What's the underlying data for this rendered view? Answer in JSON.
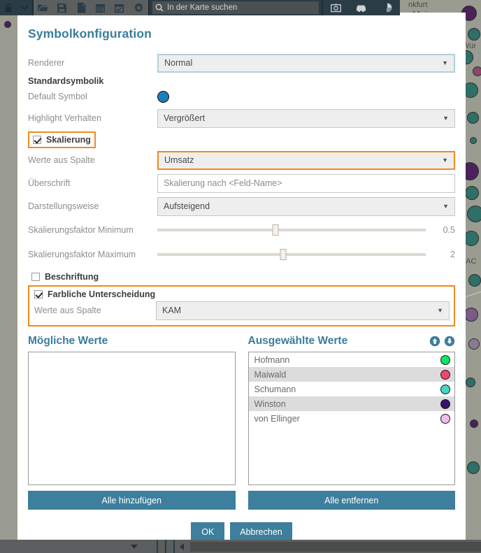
{
  "toolbar": {
    "icons": [
      {
        "name": "lock-icon",
        "label": "Sperren"
      },
      {
        "name": "chevron-down-icon",
        "label": "Mehr"
      },
      {
        "name": "folder-open-icon",
        "label": "Öffnen"
      },
      {
        "name": "save-icon",
        "label": "Speichern"
      },
      {
        "name": "new-document-icon",
        "label": "Neu"
      },
      {
        "name": "calendar-icon",
        "label": "Kalender"
      },
      {
        "name": "calendar-check-icon",
        "label": "Termin"
      },
      {
        "name": "gear-icon",
        "label": "Einstellungen"
      }
    ],
    "right_icons": [
      {
        "name": "camera-icon",
        "label": "Screenshot"
      },
      {
        "name": "car-icon",
        "label": "Route"
      },
      {
        "name": "pie-chart-icon",
        "label": "Diagramm"
      }
    ]
  },
  "search": {
    "placeholder": "In der Karte suchen",
    "icon": "search-icon"
  },
  "map": {
    "labels": [
      "nkfurt",
      "Main",
      "Wür",
      "FAC"
    ]
  },
  "dialog": {
    "title": "Symbolkonfiguration",
    "renderer": {
      "label": "Renderer",
      "value": "Normal"
    },
    "standard_section": {
      "heading": "Standardsymbolik",
      "default_symbol_label": "Default Symbol",
      "default_symbol_color": "#1b7fbd",
      "highlight_label": "Highlight Verhalten",
      "highlight_value": "Vergrößert"
    },
    "scaling": {
      "checkbox_label": "Skalierung",
      "checked": true,
      "column_label": "Werte aus Spalte",
      "column_value": "Umsatz",
      "caption_label": "Überschrift",
      "caption_value": "Skalierung nach <Feld-Name>",
      "mode_label": "Darstellungsweise",
      "mode_value": "Aufsteigend",
      "min_label": "Skalierungsfaktor Minimum",
      "min_value": "0.5",
      "min_percent": 44,
      "max_label": "Skalierungsfaktor Maximum",
      "max_value": "2",
      "max_percent": 47
    },
    "labeling": {
      "checkbox_label": "Beschriftung",
      "checked": false
    },
    "color_coding": {
      "checkbox_label": "Farbliche Unterscheidung",
      "checked": true,
      "column_label": "Werte aus Spalte",
      "column_value": "KAM"
    },
    "lists": {
      "available_title": "Mögliche Werte",
      "selected_title": "Ausgewählte Werte",
      "move_up_icon": "arrow-up-circle-icon",
      "move_down_icon": "arrow-down-circle-icon",
      "available_items": [],
      "selected_items": [
        {
          "label": "Hofmann",
          "color": "#10e466"
        },
        {
          "label": "Maiwald",
          "color": "#f2456e"
        },
        {
          "label": "Schumann",
          "color": "#3fd8c6"
        },
        {
          "label": "Winston",
          "color": "#3d0d6b"
        },
        {
          "label": "von Ellinger",
          "color": "#f0bce9"
        }
      ],
      "add_all_label": "Alle hinzufügen",
      "remove_all_label": "Alle entfernen"
    },
    "footer": {
      "ok_label": "OK",
      "cancel_label": "Abbrechen"
    },
    "accent_color": "#3a7e9c",
    "highlight_color": "#f08a1e"
  }
}
